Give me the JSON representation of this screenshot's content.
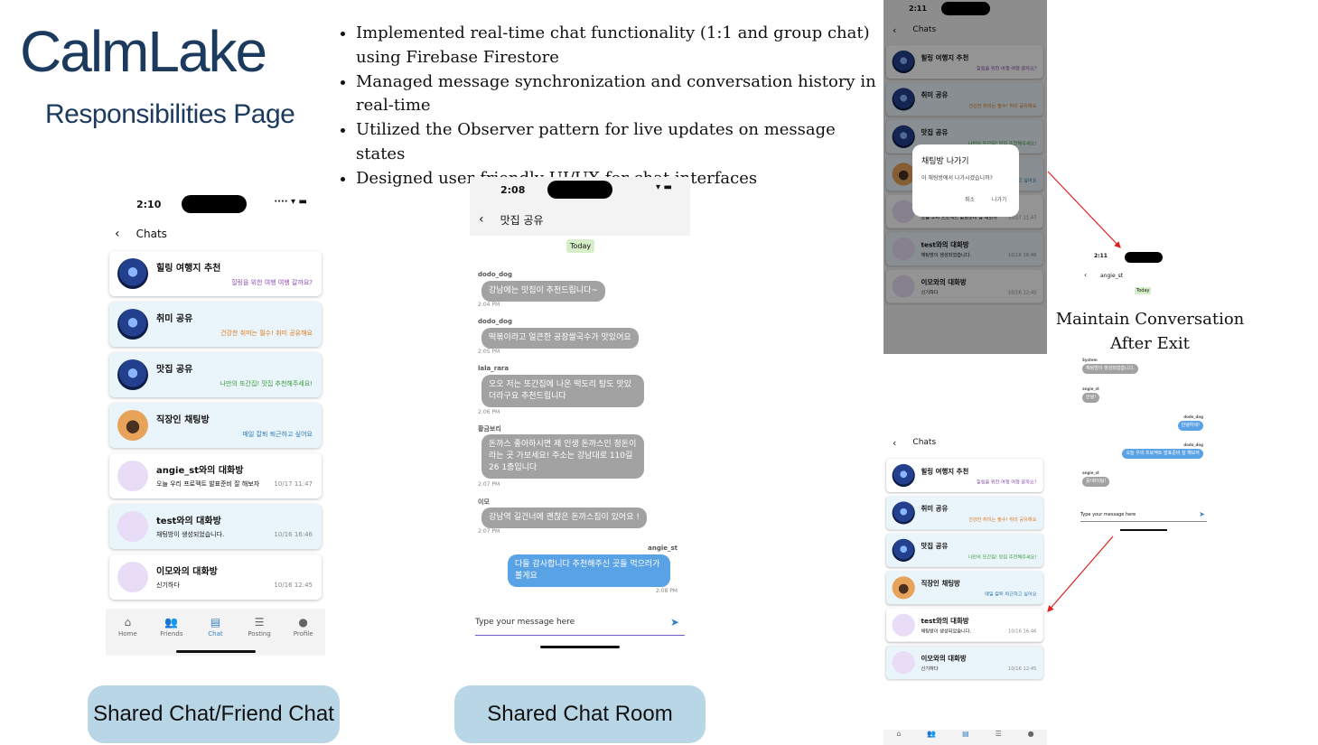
{
  "brand": {
    "title": "CalmLake",
    "subtitle": "Responsibilities Page"
  },
  "bullets": [
    "Implemented real-time chat functionality (1:1 and group chat) using Firebase Firestore",
    "Managed message synchronization and conversation history in real-time",
    "Utilized the Observer pattern for live updates on message states",
    "Designed user-friendly UI/UX for chat interfaces"
  ],
  "chat_list": {
    "time": "2:10",
    "header": "Chats",
    "items": [
      {
        "title": "힐링 여행지 추천",
        "msg": "힐링을 위한 여행 여행 갈까요?",
        "color": "#8a4fb0"
      },
      {
        "title": "취미 공유",
        "msg": "건강한 취미는 필수! 취미 공유해요",
        "color": "#e07a1f"
      },
      {
        "title": "맛집 공유",
        "msg": "나만의 또간집! 맛집 추천해주세요!",
        "color": "#3a9a3a"
      },
      {
        "title": "직장인 채팅방",
        "msg": "매일 칼퇴 퇴근하고 싶어요",
        "color": "#2b7ab0"
      },
      {
        "title": "angie_st와의 대화방",
        "preview": "오늘 우리 프로젝트 발표준비 잘 해보자",
        "date": "10/17 11:47"
      },
      {
        "title": "test와의 대화방",
        "preview": "채팅방이 생성되었습니다.",
        "date": "10/16 16:46"
      },
      {
        "title": "이모와의 대화방",
        "preview": "신기하다",
        "date": "10/16 12:45"
      }
    ]
  },
  "nav": [
    "Home",
    "Friends",
    "Chat",
    "Posting",
    "Profile"
  ],
  "room": {
    "time": "2:08",
    "title": "맛집 공유",
    "today": "Today",
    "messages": [
      {
        "sender": "dodo_dog",
        "text": "강남에는 맛집이 추천드립니다~",
        "time": "2:04 PM"
      },
      {
        "sender": "dodo_dog",
        "text": "떡볶이라고 얼큰한 공장쌀국수가 맛있어요",
        "time": "2:05 PM"
      },
      {
        "sender": "lala_rara",
        "text": "오오 저는 또간집에 나온 떡도리 탕도 맛있더라구요 추천드립니다",
        "time": "2:06 PM"
      },
      {
        "sender": "황금보리",
        "text": "돈까스 좋아하시면 제 인생 돈까스인 정돈이라는 곳 가보세요! 주소는 강남대로 110길 26 1층입니다",
        "time": "2:07 PM"
      },
      {
        "sender": "이모",
        "text": "강남역 길건너에 괜찮은 돈까스집이 있어요 !",
        "time": "2:07 PM"
      },
      {
        "sender": "angie_st",
        "text": "다들 감사합니다 추천해주신 곳들 먹으러가볼게요",
        "time": "2:08 PM"
      }
    ],
    "input_placeholder": "Type your message here"
  },
  "captions": {
    "left": "Shared Chat/Friend Chat",
    "middle": "Shared Chat Room"
  },
  "right": {
    "time": "2:11",
    "header": "Chats",
    "dialog": {
      "title": "채팅방 나가기",
      "body": "이 채팅방에서 나가시겠습니까?",
      "cancel": "취소",
      "confirm": "나가기"
    },
    "exit_title": "Maintain Conversation After Exit",
    "small_room": {
      "title": "angie_st",
      "today": "Today",
      "input_placeholder": "Type your message here",
      "messages": [
        {
          "sender": "System",
          "text": "채팅방이 생성되었습니다.",
          "side": "left"
        },
        {
          "sender": "angie_st",
          "text": "안녕!",
          "side": "left"
        },
        {
          "sender": "dodo_dog",
          "text": "안녕하세!",
          "side": "right"
        },
        {
          "sender": "dodo_dog",
          "text": "오늘 우리 프로젝트 발표준비 잘 해보자",
          "side": "right"
        },
        {
          "sender": "angie_st",
          "text": "웅!화이팅!",
          "side": "left"
        }
      ]
    },
    "list_items": [
      {
        "title": "힐링 여행지 추천",
        "msg": "힐링을 위한 여행 여행 갈까요?"
      },
      {
        "title": "취미 공유",
        "msg": "건강한 취미는 필수! 취미 공유해요"
      },
      {
        "title": "맛집 공유",
        "msg": "나만의 또간집! 맛집 추천해주세요!"
      },
      {
        "title": "직장인 채팅방",
        "msg": "매일 칼퇴 퇴근하고 싶어요"
      },
      {
        "title": "test와의 대화방",
        "preview": "채팅방이 생성되었습니다.",
        "date": "10/16 16:46"
      },
      {
        "title": "이모와의 대화방",
        "preview": "신기하다",
        "date": "10/16 12:45"
      }
    ]
  }
}
